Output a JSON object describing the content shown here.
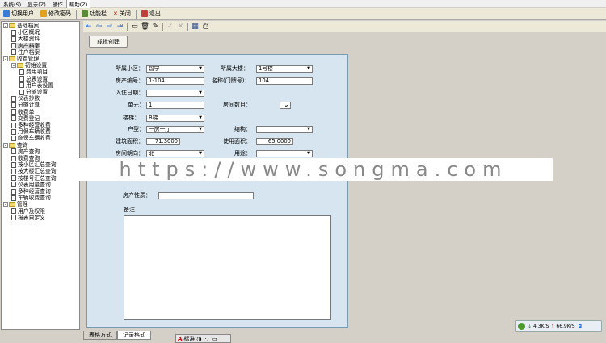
{
  "menu": [
    {
      "label": "系统(S)"
    },
    {
      "label": "显示(Z)"
    },
    {
      "label": "操作"
    },
    {
      "label": "帮助(Z)"
    }
  ],
  "toolbar": {
    "switch_user": "切换用户",
    "change_password": "修改密码",
    "function_bar": "功能栏",
    "close": "关闭",
    "exit": "退出"
  },
  "tree": [
    {
      "label": "基础档案",
      "level": 0,
      "type": "folder",
      "exp": "-"
    },
    {
      "label": "小区概况",
      "level": 1,
      "type": "doc"
    },
    {
      "label": "大楼资料",
      "level": 1,
      "type": "doc"
    },
    {
      "label": "房产档案",
      "level": 1,
      "type": "doc",
      "selected": true
    },
    {
      "label": "住户档案",
      "level": 1,
      "type": "doc"
    },
    {
      "label": "收费管理",
      "level": 0,
      "type": "folder",
      "exp": "-"
    },
    {
      "label": "初始设置",
      "level": 1,
      "type": "folder",
      "exp": "-"
    },
    {
      "label": "费用项目",
      "level": 2,
      "type": "doc"
    },
    {
      "label": "总表设置",
      "level": 2,
      "type": "doc"
    },
    {
      "label": "用户表设置",
      "level": 2,
      "type": "doc"
    },
    {
      "label": "分摊设置",
      "level": 2,
      "type": "doc"
    },
    {
      "label": "仪表抄数",
      "level": 1,
      "type": "doc"
    },
    {
      "label": "分摊计算",
      "level": 1,
      "type": "doc"
    },
    {
      "label": "收费单",
      "level": 1,
      "type": "doc"
    },
    {
      "label": "交费登记",
      "level": 1,
      "type": "doc"
    },
    {
      "label": "多种经营收费",
      "level": 1,
      "type": "doc"
    },
    {
      "label": "月保车辆收费",
      "level": 1,
      "type": "doc"
    },
    {
      "label": "临保车辆收费",
      "level": 1,
      "type": "doc"
    },
    {
      "label": "查询",
      "level": 0,
      "type": "folder",
      "exp": "-"
    },
    {
      "label": "房产查询",
      "level": 1,
      "type": "doc"
    },
    {
      "label": "收费查询",
      "level": 1,
      "type": "doc"
    },
    {
      "label": "按小区汇总查询",
      "level": 1,
      "type": "doc"
    },
    {
      "label": "按大楼汇总查询",
      "level": 1,
      "type": "doc"
    },
    {
      "label": "按楼号汇总查询",
      "level": 1,
      "type": "doc"
    },
    {
      "label": "仪表用量查询",
      "level": 1,
      "type": "doc"
    },
    {
      "label": "多种经营查询",
      "level": 1,
      "type": "doc"
    },
    {
      "label": "车辆收费查询",
      "level": 1,
      "type": "doc"
    },
    {
      "label": "管理",
      "level": 0,
      "type": "folder",
      "exp": "-"
    },
    {
      "label": "用户及权限",
      "level": 1,
      "type": "doc"
    },
    {
      "label": "报表自定义",
      "level": 1,
      "type": "doc"
    }
  ],
  "batch_button": "成批创建",
  "form": {
    "community_label": "所属小区：",
    "community_value": "碧宁",
    "building_label": "所属大楼：",
    "building_value": "1号楼",
    "house_no_label": "房产编号：",
    "house_no_value": "1-104",
    "name_label": "名称(门牌号)：",
    "name_value": "104",
    "checkin_label": "入住日期：",
    "checkin_value": "",
    "unit_label": "单元：",
    "unit_value": "1",
    "rooms_label": "房间数目：",
    "rooms_value": "",
    "stair_label": "楼梯：",
    "stair_value": "B梯",
    "type_label": "户型：",
    "type_value": "一房一厅",
    "structure_label": "结构：",
    "structure_value": "",
    "build_area_label": "建筑面积：",
    "build_area_value": "71.3000",
    "use_area_label": "使用面积：",
    "use_area_value": "65.0000",
    "orient_label": "房间朝向：",
    "orient_value": "北",
    "usage_label": "用途：",
    "usage_value": "",
    "nature_label": "房产性质：",
    "nature_value": "",
    "remark_label": "备注"
  },
  "watermark": "https://www.songma.com",
  "tabs": [
    {
      "label": "表格方式"
    },
    {
      "label": "记录格式"
    }
  ],
  "ime": {
    "mode": "标准"
  },
  "net": {
    "down": "4.3K/S",
    "up": "66.9K/S"
  }
}
